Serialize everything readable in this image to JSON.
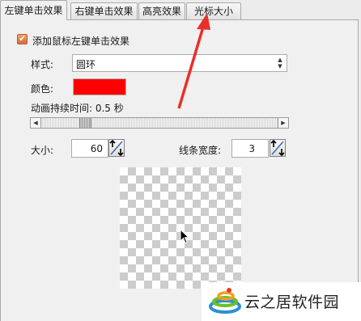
{
  "tabs": [
    {
      "label": "左键单击效果",
      "active": true
    },
    {
      "label": "右键单击效果",
      "active": false
    },
    {
      "label": "高亮效果",
      "active": false
    },
    {
      "label": "光标大小",
      "active": false
    }
  ],
  "left_click": {
    "enable_checkbox_label": "添加鼠标左键单击效果",
    "enable_checked": true,
    "style_label": "样式:",
    "style_value": "圆环",
    "color_label": "颜色:",
    "color_value": "#ff0000",
    "duration_label": "动画持续时间: 0.5 秒",
    "duration_value": 0.5,
    "size_label": "大小:",
    "size_value": "60",
    "line_width_label": "线条宽度:",
    "line_width_value": "3"
  },
  "preview": {
    "cursor_icon": "arrow-cursor-icon"
  },
  "annotation": {
    "arrow_color": "#e8302a"
  },
  "watermark": {
    "text": "云之居软件园"
  }
}
